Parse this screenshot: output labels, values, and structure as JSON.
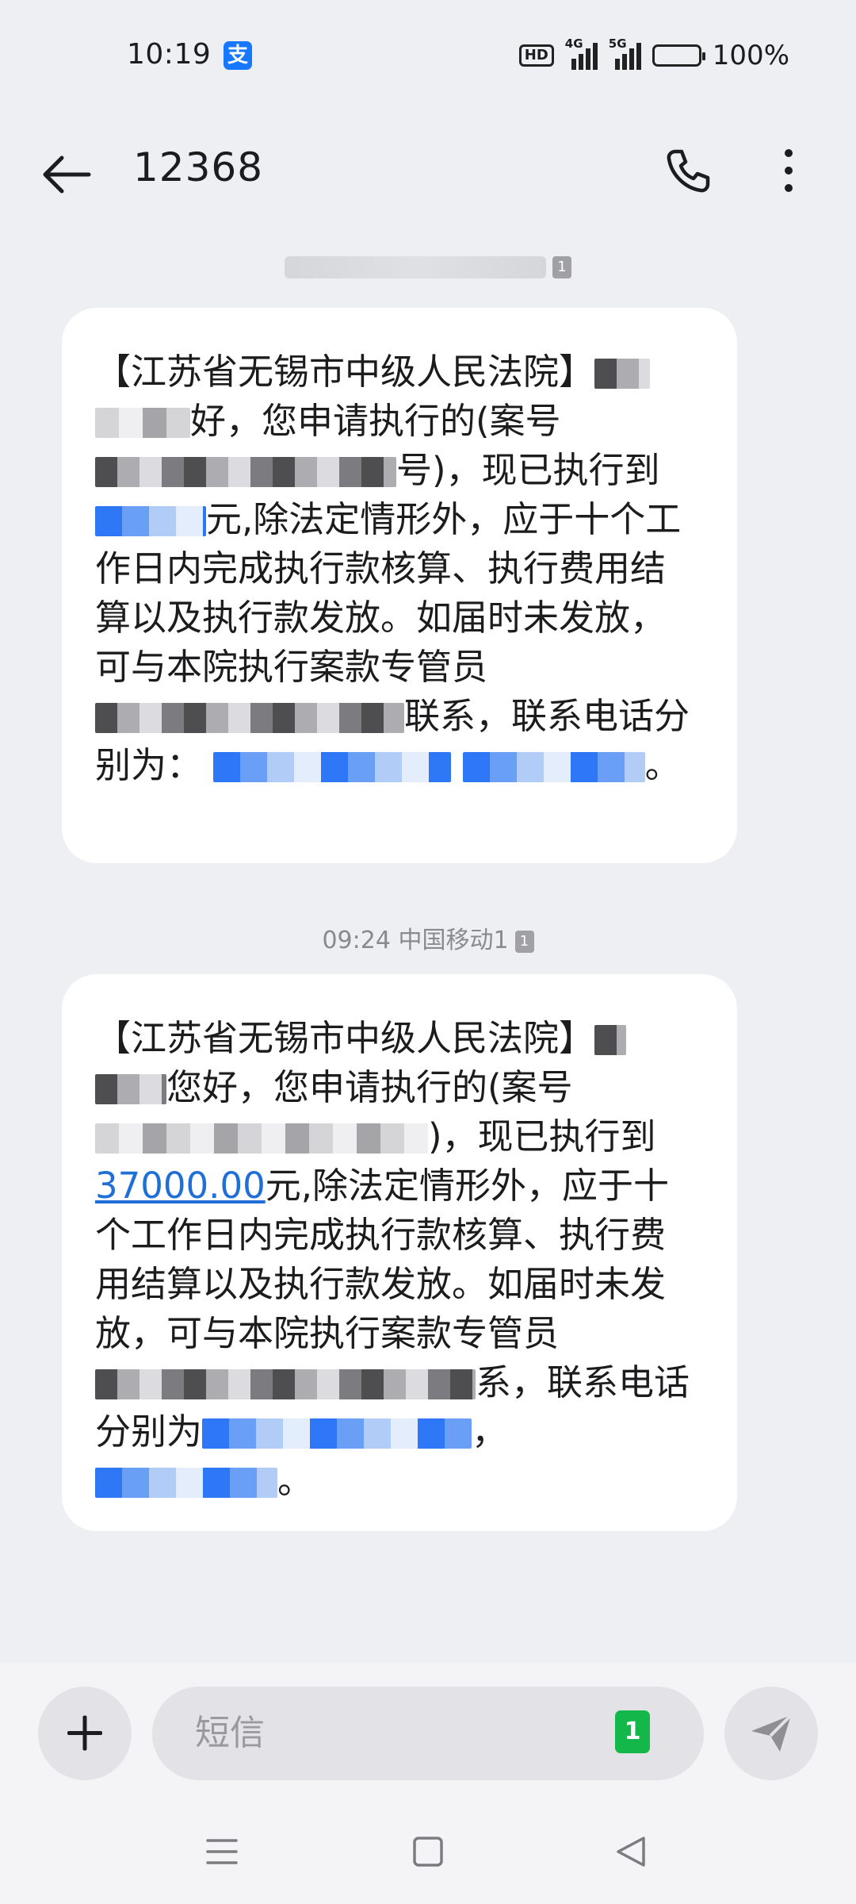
{
  "status_bar": {
    "time": "10:19",
    "alipay_label": "支",
    "hd_label": "HD",
    "net1": "4G",
    "net2": "5G",
    "battery": "100%"
  },
  "header": {
    "title": "12368"
  },
  "messages": [
    {
      "stamp_sim": "1",
      "p1": "【江苏省无锡市中级人民法院】",
      "p2": "好，您申请执行的(案号",
      "p3": "号)，现已执行到",
      "p4": "元,除法定情形外，应于十个工作日内完成执行款核算、执行费用结算以及执行款发放。如届时未发放，可与本院执行案款专管员",
      "p5": "联系，联系电话分别为：",
      "p6": "。"
    },
    {
      "stamp": "09:24  中国移动1",
      "stamp_sim": "1",
      "p1": "【江苏省无锡市中级人民法院】",
      "p2": "您好，您申请执行的(案号",
      "p3": ")，现已执行到",
      "amount": "37000.00",
      "p4": "元,除法定情形外，应于十个工作日内完成执行款核算、执行费用结算以及执行款发放。如届时未发放，可与本院执行案款专管员",
      "p5": "系，联系电话分别为",
      "p6": "，",
      "p7": "。"
    }
  ],
  "input": {
    "placeholder": "短信",
    "sim_badge": "1"
  }
}
